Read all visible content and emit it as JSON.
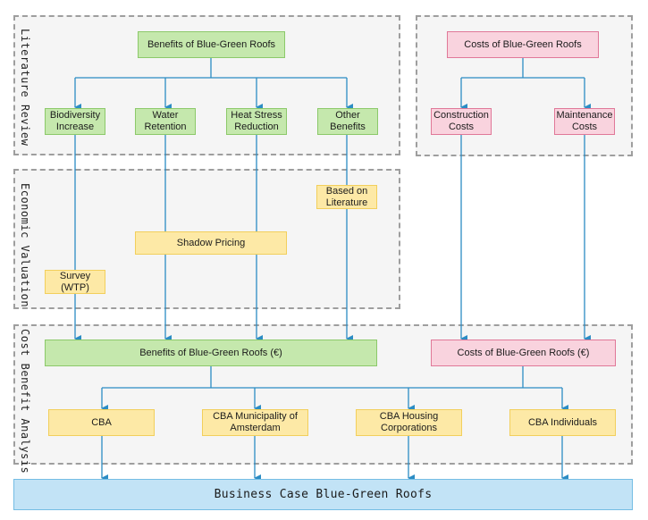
{
  "regions": {
    "literature_review": "Literature Review",
    "economic_valuation": "Economic Valuation",
    "cost_benefit_analysis": "Cost Benefit Analysis"
  },
  "nodes": {
    "benefits_top": "Benefits of Blue-Green Roofs",
    "costs_top": "Costs of Blue-Green Roofs",
    "biodiversity": "Biodiversity Increase",
    "water_retention": "Water Retention",
    "heat_stress": "Heat Stress Reduction",
    "other_benefits": "Other Benefits",
    "construction_costs": "Construction Costs",
    "maintenance_costs": "Maintenance Costs",
    "based_on_literature": "Based on Literature",
    "shadow_pricing": "Shadow Pricing",
    "survey": "Survey (WTP)",
    "benefits_eur": "Benefits of Blue-Green Roofs (€)",
    "costs_eur": "Costs of Blue-Green Roofs (€)",
    "cba": "CBA",
    "cba_municipality": "CBA Municipality of Amsterdam",
    "cba_housing": "CBA Housing Corporations",
    "cba_individuals": "CBA Individuals",
    "business_case": "Business Case Blue-Green Roofs"
  },
  "colors": {
    "benefit_green": "#c5e8ad",
    "cost_pink": "#f9d3de",
    "method_yellow": "#fde9a6",
    "outcome_blue": "#c2e3f6",
    "connector": "#2b8cc4"
  }
}
